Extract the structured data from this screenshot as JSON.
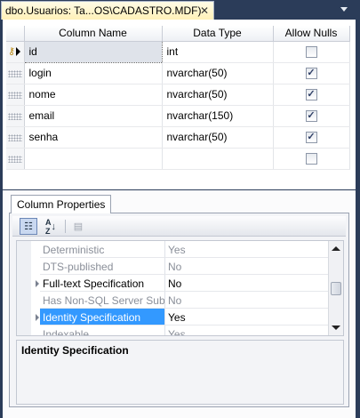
{
  "tab": {
    "title": "dbo.Usuarios: Ta...OS\\CADASTRO.MDF)",
    "close_glyph": "✕"
  },
  "grid": {
    "headers": [
      "Column Name",
      "Data Type",
      "Allow Nulls"
    ],
    "rows": [
      {
        "name": "id",
        "type": "int",
        "allow_nulls": false,
        "primary_key": true
      },
      {
        "name": "login",
        "type": "nvarchar(50)",
        "allow_nulls": true
      },
      {
        "name": "nome",
        "type": "nvarchar(50)",
        "allow_nulls": true
      },
      {
        "name": "email",
        "type": "nvarchar(150)",
        "allow_nulls": true
      },
      {
        "name": "senha",
        "type": "nvarchar(50)",
        "allow_nulls": true
      },
      {
        "name": "",
        "type": "",
        "allow_nulls": false
      }
    ]
  },
  "properties": {
    "tab_label": "Column Properties",
    "toolbar": {
      "categorized_icon": "categorized-icon",
      "alphabetical_icon": "alphabetical-sort-icon",
      "pages_icon": "property-pages-icon"
    },
    "rows": [
      {
        "name": "Deterministic",
        "value": "Yes",
        "readonly": true,
        "expandable": false
      },
      {
        "name": "DTS-published",
        "value": "No",
        "readonly": true,
        "expandable": false
      },
      {
        "name": "Full-text Specification",
        "value": "No",
        "readonly": false,
        "expandable": true
      },
      {
        "name": "Has Non-SQL Server Sub",
        "value": "No",
        "readonly": true,
        "expandable": false
      },
      {
        "name": "Identity Specification",
        "value": "Yes",
        "readonly": false,
        "expandable": true,
        "selected": true
      },
      {
        "name": "Indexable",
        "value": "Yes",
        "readonly": true,
        "expandable": false
      }
    ],
    "description_title": "Identity Specification"
  },
  "colors": {
    "frame": "#2b3c59",
    "selection": "#3399ff",
    "tab_active": "#fff1b8"
  }
}
